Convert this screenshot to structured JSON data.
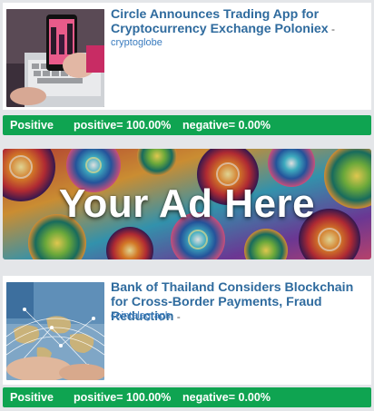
{
  "colors": {
    "background": "#e4e6e9",
    "card": "#ffffff",
    "headline": "#2f6b9e",
    "source": "#3a7cbf",
    "positive_bar": "#0fa451"
  },
  "articles": [
    {
      "title": "Circle Announces Trading App for Cryptocurrency Exchange Poloniex",
      "separator": " -",
      "source": "cryptoglobe",
      "thumbnail_icon": "laptop-phone-photo",
      "sentiment": {
        "label": "Positive",
        "positive": "positive= 100.00%",
        "negative": "negative= 0.00%"
      }
    },
    {
      "title": "Bank of Thailand Considers Blockchain for Cross-Border Payments, Fraud Reduction",
      "separator": " -",
      "source": "cointelegraph",
      "thumbnail_icon": "world-map-network-photo",
      "sentiment": {
        "label": "Positive",
        "positive": "positive= 100.00%",
        "negative": "negative= 0.00%"
      }
    }
  ],
  "ad": {
    "text": "Your Ad Here"
  }
}
